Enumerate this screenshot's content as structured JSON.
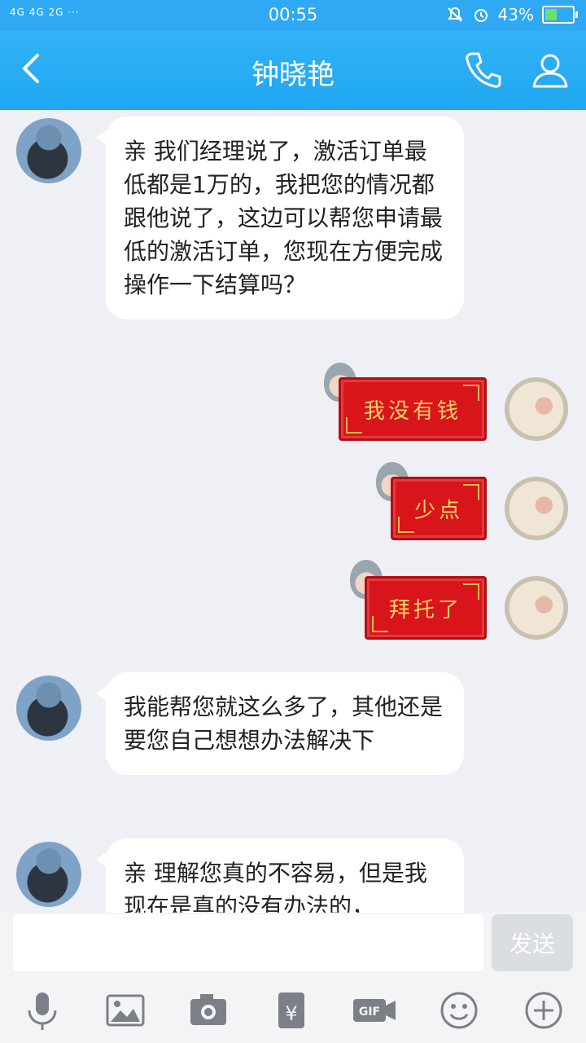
{
  "status": {
    "network": "4G 4G 2G ···",
    "time": "00:55",
    "battery": "43%"
  },
  "header": {
    "title": "钟晓艳"
  },
  "messages": [
    {
      "side": "left",
      "text": "亲 我们经理说了，激活订单最低都是1万的，我把您的情况都跟他说了，这边可以帮您申请最低的激活订单，您现在方便完成操作一下结算吗？"
    },
    {
      "side": "right",
      "sticker_text": "我没有钱"
    },
    {
      "side": "right",
      "sticker_text": "少点"
    },
    {
      "side": "right",
      "sticker_text": "拜托了"
    },
    {
      "side": "left",
      "text": "我能帮您就这么多了，其他还是要您自己想想办法解决下"
    },
    {
      "side": "left",
      "text": "亲 理解您真的不容易，但是我现在是真的没有办法的，"
    }
  ],
  "input": {
    "placeholder": "",
    "send_label": "发送"
  },
  "toolbar": [
    "mic-icon",
    "image-icon",
    "camera-icon",
    "red-packet-icon",
    "gif-icon",
    "emoji-icon",
    "plus-icon"
  ]
}
